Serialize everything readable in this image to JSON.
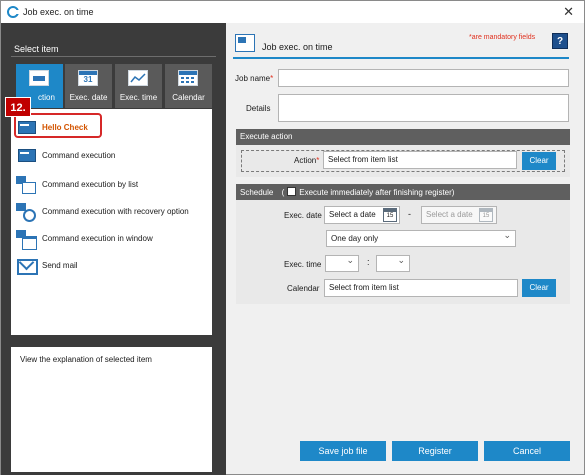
{
  "window": {
    "title": "Job exec. on time",
    "close_glyph": "✕"
  },
  "left": {
    "title": "Select item",
    "tabs": [
      {
        "label": "Action",
        "icon": "terminal-icon",
        "visible_text": "ction"
      },
      {
        "label": "Exec. date",
        "icon": "calendar-31-icon",
        "day": "31"
      },
      {
        "label": "Exec. time",
        "icon": "chart-icon"
      },
      {
        "label": "Calendar",
        "icon": "calendar-grid-icon"
      }
    ],
    "step_badge": "12.",
    "items": [
      {
        "label": "Hello Check",
        "icon": "hello-check-icon"
      },
      {
        "label": "Command execution",
        "icon": "terminal-icon"
      },
      {
        "label": "Command execution by list",
        "icon": "list-icon"
      },
      {
        "label": "Command execution with recovery option",
        "icon": "recovery-icon"
      },
      {
        "label": "Command execution in window",
        "icon": "window-icon"
      },
      {
        "label": "Send mail",
        "icon": "mail-icon"
      }
    ],
    "description": "View the explanation of selected item"
  },
  "right": {
    "title": "Job exec. on time",
    "mandatory_note": "*are mandatory fields",
    "help_label": "?",
    "job_name_label": "Job name",
    "job_name_value": "",
    "details_label": "Details",
    "details_value": "",
    "execute_action": {
      "header": "Execute action",
      "action_label": "Action",
      "action_value": "Select from item list",
      "clear_label": "Clear"
    },
    "schedule": {
      "header": "Schedule",
      "paren": "(",
      "immediate_label": "Execute immediately after finishing register)",
      "exec_date_label": "Exec. date",
      "date_from_placeholder": "Select a date",
      "date_to_placeholder": "Select a date",
      "date_separator": "-",
      "cal_day": "15",
      "repeat_option": "One day only",
      "exec_time_label": "Exec. time",
      "hour_value": "",
      "time_separator": ":",
      "minute_value": "",
      "calendar_label": "Calendar",
      "calendar_value": "Select from item list",
      "clear_label": "Clear"
    },
    "buttons": {
      "save": "Save job file",
      "register": "Register",
      "cancel": "Cancel"
    }
  },
  "colors": {
    "accent": "#1e88c8",
    "dark_panel": "#3b3b3b",
    "tab_inactive": "#5a5a5a",
    "badge_red": "#c00000",
    "required": "#e0301e",
    "hello_check": "#d35400"
  }
}
